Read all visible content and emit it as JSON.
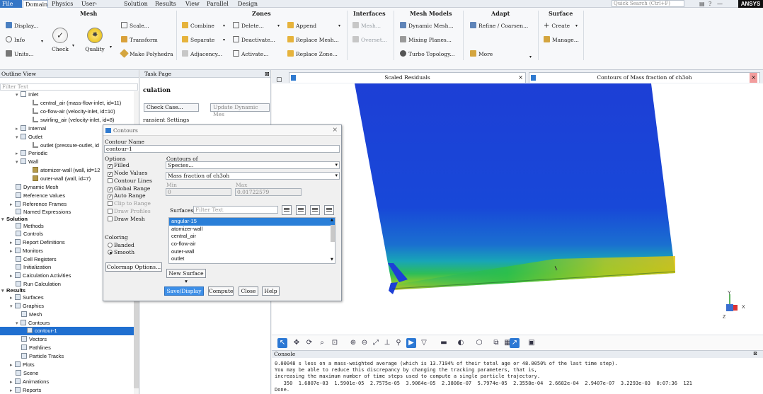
{
  "menubar": {
    "items": [
      "File",
      "Domain",
      "Physics",
      "User-Defined",
      "Solution",
      "Results",
      "View",
      "Parallel",
      "Design"
    ],
    "search_placeholder": "Quick Search (Ctrl+F)",
    "brand": "ANSYS"
  },
  "ribbon": {
    "mesh": {
      "title": "Mesh",
      "display": "Display...",
      "info": "Info",
      "units": "Units...",
      "check": "Check",
      "quality": "Quality",
      "scale": "Scale...",
      "transform": "Transform",
      "make_polyhedra": "Make Polyhedra"
    },
    "zones": {
      "title": "Zones",
      "combine": "Combine",
      "separate": "Separate",
      "adjacency": "Adjacency...",
      "delete": "Delete...",
      "deactivate": "Deactivate...",
      "activate": "Activate...",
      "append": "Append",
      "replace_mesh": "Replace Mesh...",
      "replace_zone": "Replace Zone..."
    },
    "interfaces": {
      "title": "Interfaces",
      "mesh": "Mesh...",
      "overset": "Overset..."
    },
    "mesh_models": {
      "title": "Mesh Models",
      "dynamic_mesh": "Dynamic Mesh...",
      "mixing_planes": "Mixing Planes...",
      "turbo_topology": "Turbo Topology..."
    },
    "adapt": {
      "title": "Adapt",
      "refine_coarsen": "Refine / Coarsen...",
      "more": "More"
    },
    "surface": {
      "title": "Surface",
      "create": "Create",
      "manage": "Manage..."
    }
  },
  "outline": {
    "title": "Outline View",
    "filter_placeholder": "Filter Text",
    "items": [
      "Inlet",
      "central_air (mass-flow-inlet, id=11)",
      "co-flow-air (velocity-inlet, id=10)",
      "swirling_air (velocity-inlet, id=8)",
      "Internal",
      "Outlet",
      "outlet (pressure-outlet, id",
      "Periodic",
      "Wall",
      "atomizer-wall (wall, id=12",
      "outer-wall (wall, id=7)",
      "Dynamic Mesh",
      "Reference Values",
      "Reference Frames",
      "Named Expressions",
      "Solution",
      "Methods",
      "Controls",
      "Report Definitions",
      "Monitors",
      "Cell Registers",
      "Initialization",
      "Calculation Activities",
      "Run Calculation",
      "Results",
      "Surfaces",
      "Graphics",
      "Mesh",
      "Contours",
      "contour-1",
      "Vectors",
      "Pathlines",
      "Particle Tracks",
      "Plots",
      "Scene",
      "Animations",
      "Reports"
    ]
  },
  "task": {
    "title": "Task Page",
    "heading": "culation",
    "check_case": "Check Case...",
    "update_dynamic_mesh": "Update Dynamic Mes",
    "transient_settings": "ransient Settings"
  },
  "dialog": {
    "title": "Contours",
    "contour_name_label": "Contour Name",
    "contour_name": "contour-1",
    "options_label": "Options",
    "options": [
      {
        "label": "Filled",
        "checked": true,
        "enabled": true
      },
      {
        "label": "Node Values",
        "checked": true,
        "enabled": true
      },
      {
        "label": "Contour Lines",
        "checked": false,
        "enabled": true
      },
      {
        "label": "Global Range",
        "checked": true,
        "enabled": true
      },
      {
        "label": "Auto Range",
        "checked": true,
        "enabled": true
      },
      {
        "label": "Clip to Range",
        "checked": false,
        "enabled": false
      },
      {
        "label": "Draw Profiles",
        "checked": false,
        "enabled": false
      },
      {
        "label": "Draw Mesh",
        "checked": false,
        "enabled": true
      }
    ],
    "contours_of_label": "Contours of",
    "contours_of_category": "Species...",
    "contours_of_field": "Mass fraction of ch3oh",
    "min_label": "Min",
    "min_value": "0",
    "max_label": "Max",
    "max_value": "0.01722579",
    "surfaces_label": "Surfaces",
    "surfaces_filter_placeholder": "Filter Text",
    "surfaces": [
      "angular-15",
      "atomizer-wall",
      "central_air",
      "co-flow-air",
      "outer-wall",
      "outlet"
    ],
    "coloring_label": "Coloring",
    "coloring_banded": "Banded",
    "coloring_smooth": "Smooth",
    "colormap_options": "Colormap Options...",
    "new_surface": "New Surface",
    "save_display": "Save/Display",
    "compute": "Compute",
    "close": "Close",
    "help": "Help"
  },
  "graphics": {
    "tab1": "Scaled Residuals",
    "tab2": "Contours of Mass fraction of ch3oh"
  },
  "console": {
    "title": "Console",
    "lines": [
      "0.00048 s less on a mass-weighted average (which is 13.7194% of their total age or 48.0050% of the last time step).",
      "You may be able to reduce this discrepancy by changing the tracking parameters, that is,",
      "increasing the maximum number of time steps used to compute a single particle trajectory.",
      "   350  1.6807e-03  1.5901e-05  2.7575e-05  3.9064e-05  2.3808e-07  5.7974e-05  2.3558e-04  2.6682e-04  2.9407e-07  3.2293e-03  0:07:36  121",
      "Done."
    ]
  },
  "colors": {
    "accent": "#1f6fd0",
    "contour_low": "#1f3fd8",
    "contour_high": "#e8c400"
  }
}
